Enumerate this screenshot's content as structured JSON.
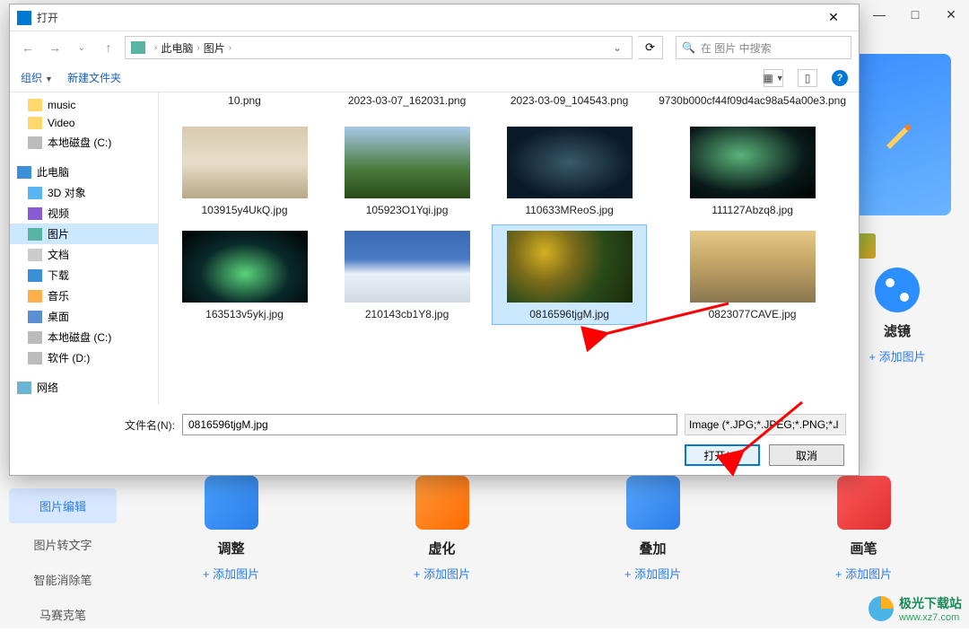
{
  "bg": {
    "win_min": "—",
    "win_max": "□",
    "win_close": "✕",
    "sidebar": [
      {
        "label": "图片编辑",
        "active": true
      },
      {
        "label": "图片转文字",
        "active": false
      },
      {
        "label": "智能消除笔",
        "active": false
      },
      {
        "label": "马赛克笔",
        "active": false
      }
    ],
    "tools": [
      {
        "name": "调整",
        "add": "+ 添加图片"
      },
      {
        "name": "虚化",
        "add": "+ 添加图片"
      },
      {
        "name": "叠加",
        "add": "+ 添加图片"
      },
      {
        "name": "画笔",
        "add": "+ 添加图片"
      }
    ],
    "right_panel": {
      "title": "滤镜",
      "add": "+ 添加图片"
    }
  },
  "dialog": {
    "title": "打开",
    "nav": {
      "back": "←",
      "fwd": "→",
      "up": "↑"
    },
    "breadcrumb": [
      "此电脑",
      "图片"
    ],
    "refresh": "⟳",
    "search_placeholder": "在 图片 中搜索",
    "toolbar": {
      "organize": "组织",
      "newfolder": "新建文件夹"
    },
    "tree": [
      {
        "icon": "folder",
        "label": "music",
        "level": 2
      },
      {
        "icon": "folder",
        "label": "Video",
        "level": 2
      },
      {
        "icon": "disk",
        "label": "本地磁盘 (C:)",
        "level": 2
      },
      {
        "sep": true
      },
      {
        "icon": "pc",
        "label": "此电脑",
        "level": 1
      },
      {
        "icon": "3d",
        "label": "3D 对象",
        "level": 2
      },
      {
        "icon": "video",
        "label": "视频",
        "level": 2
      },
      {
        "icon": "pic",
        "label": "图片",
        "level": 2,
        "selected": true
      },
      {
        "icon": "doc",
        "label": "文档",
        "level": 2
      },
      {
        "icon": "down",
        "label": "下载",
        "level": 2
      },
      {
        "icon": "music",
        "label": "音乐",
        "level": 2
      },
      {
        "icon": "desk",
        "label": "桌面",
        "level": 2
      },
      {
        "icon": "disk",
        "label": "本地磁盘 (C:)",
        "level": 2
      },
      {
        "icon": "disk",
        "label": "软件 (D:)",
        "level": 2
      },
      {
        "sep": true
      },
      {
        "icon": "net",
        "label": "网络",
        "level": 1
      }
    ],
    "grid_row1_labels": [
      "10.png",
      "2023-03-07_162031.png",
      "2023-03-09_104543.png",
      "9730b000cf44f09d4ac98a54a00e3.png"
    ],
    "grid_row2": [
      {
        "img": "img-a",
        "label": "103915y4UkQ.jpg"
      },
      {
        "img": "img-b",
        "label": "105923O1Yqi.jpg"
      },
      {
        "img": "img-c",
        "label": "110633MReoS.jpg"
      },
      {
        "img": "img-d",
        "label": "111127Abzq8.jpg"
      }
    ],
    "grid_row3": [
      {
        "img": "img-e",
        "label": "163513v5ykj.jpg"
      },
      {
        "img": "img-f",
        "label": "210143cb1Y8.jpg"
      },
      {
        "img": "img-g",
        "label": "0816596tjgM.jpg",
        "selected": true
      },
      {
        "img": "img-h",
        "label": "0823077CAVE.jpg"
      }
    ],
    "filename_label": "文件名(N):",
    "filename_value": "0816596tjgM.jpg",
    "filter_value": "Image (*.JPG;*.JPEG;*.PNG;*.I",
    "btn_open": "打开(O)",
    "btn_cancel": "取消"
  },
  "watermark": {
    "name": "极光下载站",
    "url": "www.xz7.com"
  }
}
